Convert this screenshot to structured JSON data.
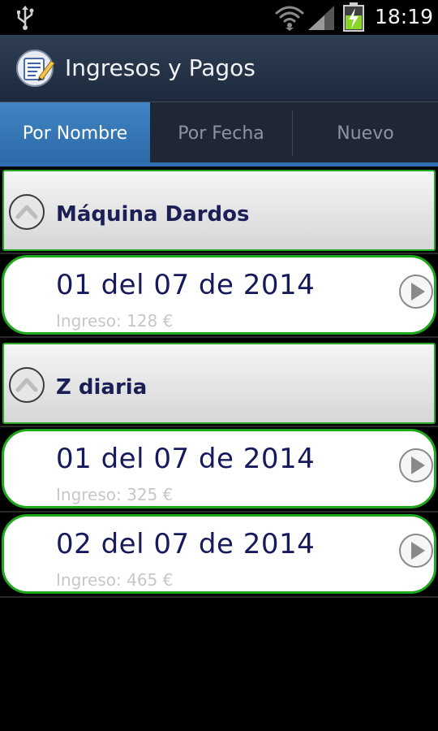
{
  "status_bar": {
    "time": "18:19",
    "icons": [
      "usb-icon",
      "wifi-icon",
      "signal-icon",
      "battery-charging-icon"
    ]
  },
  "action_bar": {
    "title": "Ingresos y Pagos",
    "icon": "app-notebook-icon"
  },
  "tabs": [
    {
      "label": "Por Nombre",
      "active": true
    },
    {
      "label": "Por Fecha",
      "active": false
    },
    {
      "label": "Nuevo",
      "active": false
    }
  ],
  "groups": [
    {
      "title": "Máquina Dardos",
      "entries": [
        {
          "date": "01 del 07 de 2014",
          "amount": "Ingreso: 128 €"
        }
      ]
    },
    {
      "title": "Z diaria",
      "entries": [
        {
          "date": "01 del 07 de 2014",
          "amount": "Ingreso: 325 €"
        },
        {
          "date": "02 del 07 de 2014",
          "amount": "Ingreso: 465 €"
        }
      ]
    }
  ],
  "colors": {
    "accent_tab": "#3a7bbd",
    "border_green": "#1fa81c",
    "title_text": "#1b1f55"
  }
}
